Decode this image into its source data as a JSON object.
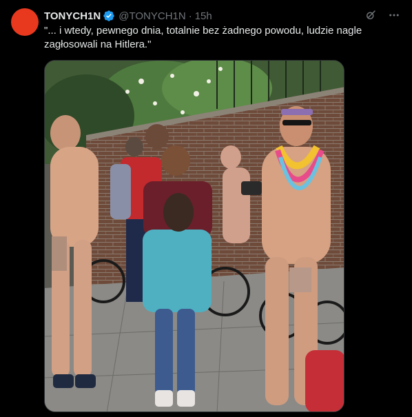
{
  "tweet": {
    "author": {
      "display_name": "TONYCH1N",
      "handle": "@TONYCH1N",
      "avatar_color": "#e8391f",
      "verified": true
    },
    "separator": "·",
    "timestamp": "15h",
    "text": "\"... i wtedy, pewnego dnia, totalnie bez żadnego powodu, ludzie nagle zagłosowali na Hitlera.\"",
    "media": {
      "type": "photo"
    },
    "actions": {
      "grok_icon": "grok-icon",
      "more_icon": "more-icon"
    }
  },
  "colors": {
    "background": "#000000",
    "text_primary": "#e7e9ea",
    "text_secondary": "#71767b",
    "verified_blue": "#1d9bf0"
  }
}
